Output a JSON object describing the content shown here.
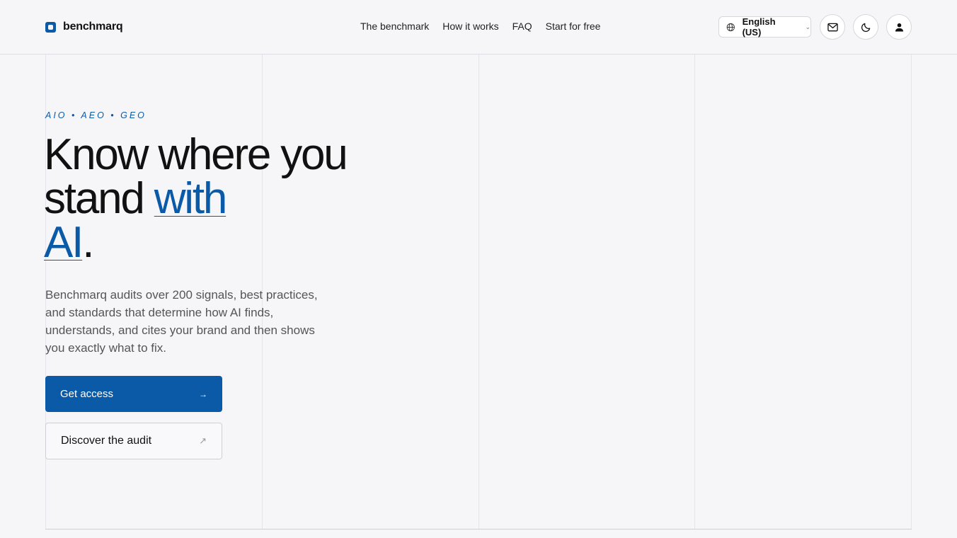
{
  "brand": {
    "name": "benchmarq",
    "accent": "#0a5aa8"
  },
  "nav": {
    "items": [
      {
        "label": "The benchmark"
      },
      {
        "label": "How it works"
      },
      {
        "label": "FAQ"
      },
      {
        "label": "Start for free"
      }
    ]
  },
  "toolbar": {
    "language": "English (US)",
    "icons": [
      "globe-icon",
      "mail-icon",
      "moon-icon",
      "user-icon"
    ]
  },
  "hero": {
    "eyebrow": "AIO • AEO • GEO",
    "headline_part1": "Know where you stand ",
    "headline_accent1": "with",
    "headline_accent2": "AI",
    "headline_end": ".",
    "lede": "Benchmarq audits over 200 signals, best practices, and standards that determine how AI finds, understands, and cites your brand and then shows you exactly what to fix.",
    "primary_cta": "Get access",
    "primary_arrow": "→",
    "secondary_cta": "Discover the audit",
    "secondary_arrow": "↗"
  }
}
